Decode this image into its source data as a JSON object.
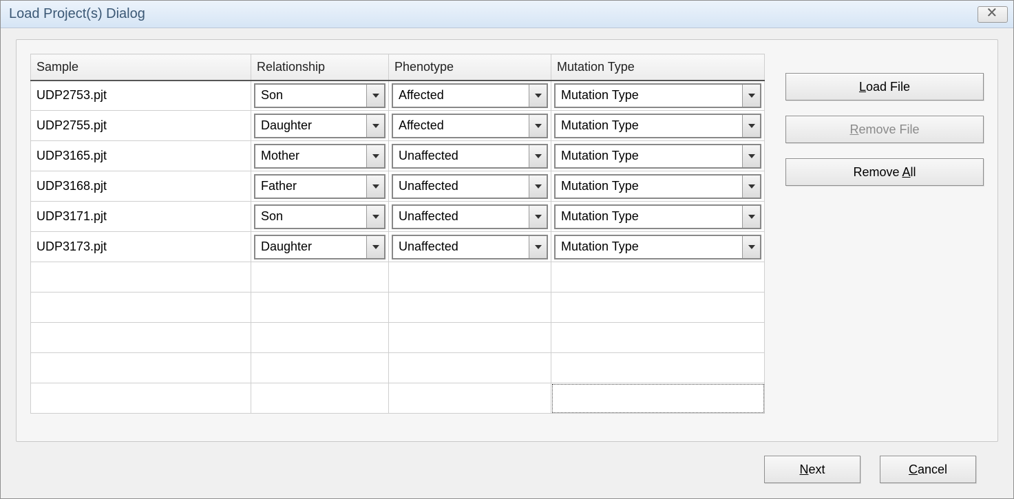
{
  "window": {
    "title": "Load Project(s) Dialog"
  },
  "table": {
    "headers": {
      "sample": "Sample",
      "relationship": "Relationship",
      "phenotype": "Phenotype",
      "mutation": "Mutation Type"
    },
    "rows": [
      {
        "sample": "UDP2753.pjt",
        "relationship": "Son",
        "phenotype": "Affected",
        "mutation": "Mutation Type"
      },
      {
        "sample": "UDP2755.pjt",
        "relationship": "Daughter",
        "phenotype": "Affected",
        "mutation": "Mutation Type"
      },
      {
        "sample": "UDP3165.pjt",
        "relationship": "Mother",
        "phenotype": "Unaffected",
        "mutation": "Mutation Type"
      },
      {
        "sample": "UDP3168.pjt",
        "relationship": "Father",
        "phenotype": "Unaffected",
        "mutation": "Mutation Type"
      },
      {
        "sample": "UDP3171.pjt",
        "relationship": "Son",
        "phenotype": "Unaffected",
        "mutation": "Mutation Type"
      },
      {
        "sample": "UDP3173.pjt",
        "relationship": "Daughter",
        "phenotype": "Unaffected",
        "mutation": "Mutation Type"
      }
    ],
    "empty_rows": 5
  },
  "buttons": {
    "load_file_pre": "",
    "load_file_m": "L",
    "load_file_post": "oad File",
    "remove_file_pre": "",
    "remove_file_m": "R",
    "remove_file_post": "emove File",
    "remove_all_pre": "Remove ",
    "remove_all_m": "A",
    "remove_all_post": "ll",
    "next_pre": "",
    "next_m": "N",
    "next_post": "ext",
    "cancel_pre": "",
    "cancel_m": "C",
    "cancel_post": "ancel"
  }
}
